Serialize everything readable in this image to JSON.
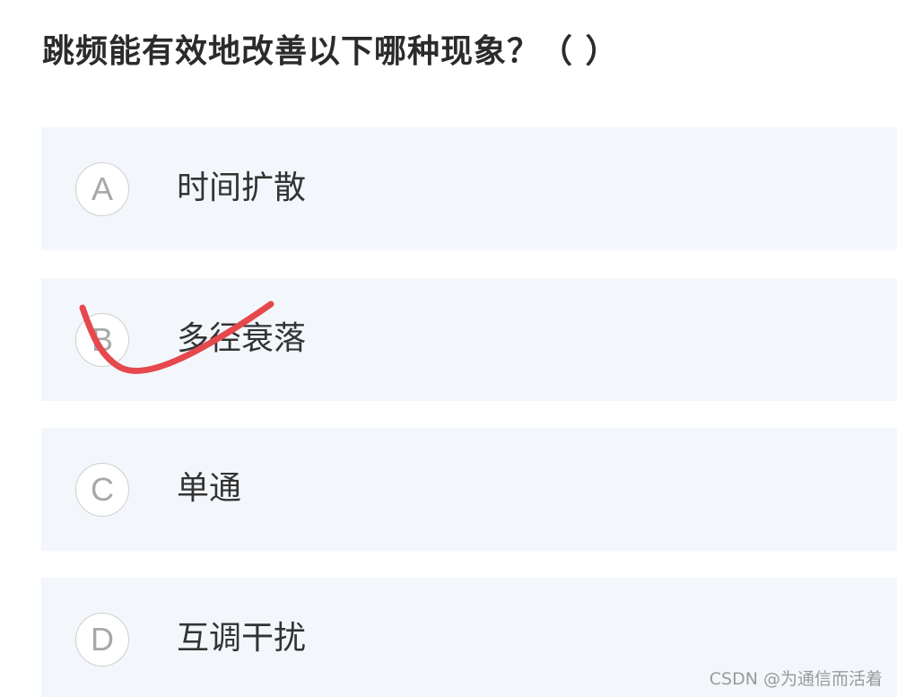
{
  "question": {
    "title": "跳频能有效地改善以下哪种现象？（ ）"
  },
  "options": [
    {
      "letter": "A",
      "text": "时间扩散"
    },
    {
      "letter": "B",
      "text": "多径衰落"
    },
    {
      "letter": "C",
      "text": "单通"
    },
    {
      "letter": "D",
      "text": "互调干扰"
    }
  ],
  "annotation": {
    "checkmark_color": "#e5484d",
    "icon": "handwritten-checkmark"
  },
  "watermark": {
    "text": "CSDN @为通信而活着"
  }
}
